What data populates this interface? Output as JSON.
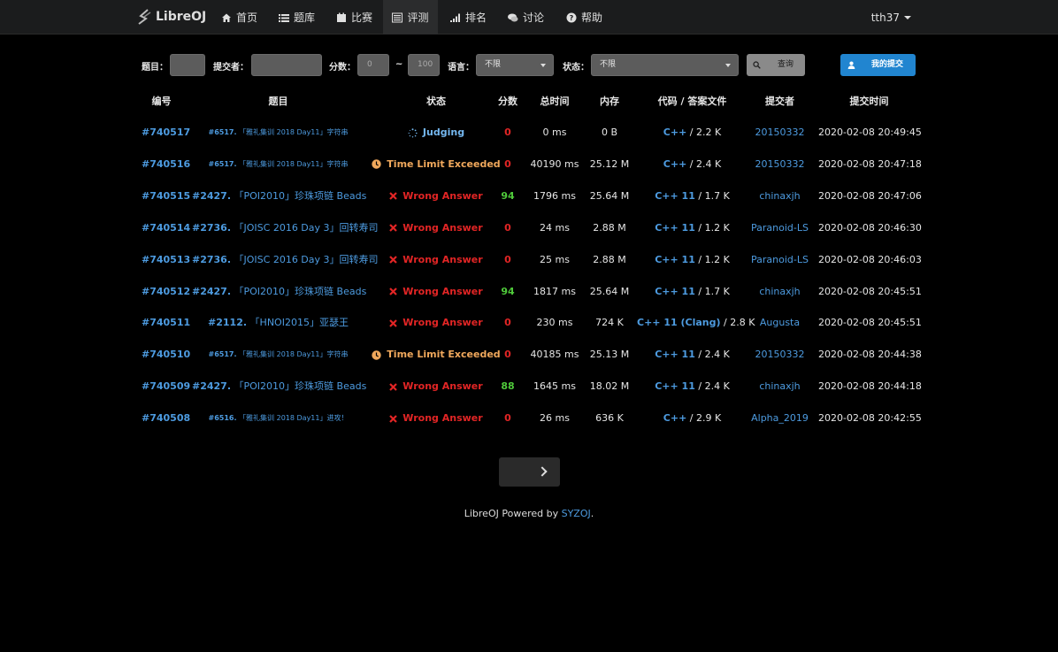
{
  "nav": {
    "brand": "LibreOJ",
    "items": [
      {
        "label": "首页",
        "icon": "home-icon"
      },
      {
        "label": "题库",
        "icon": "list-icon"
      },
      {
        "label": "比赛",
        "icon": "calendar-icon"
      },
      {
        "label": "评测",
        "icon": "tasks-icon"
      },
      {
        "label": "排名",
        "icon": "signal-icon"
      },
      {
        "label": "讨论",
        "icon": "comments-icon"
      },
      {
        "label": "帮助",
        "icon": "help-icon"
      }
    ],
    "user": "tth37"
  },
  "filter": {
    "problem_label": "题目：",
    "submitter_label": "提交者：",
    "score_label": "分数：",
    "score_min_placeholder": "0",
    "tilde": "~",
    "score_max_placeholder": "100",
    "language_label": "语言：",
    "language_value": "不限",
    "status_label": "状态：",
    "status_value": "不限",
    "query_button": "查询",
    "my_submissions_button": "我的提交"
  },
  "table": {
    "headers": [
      "编号",
      "题目",
      "状态",
      "分数",
      "总时间",
      "内存",
      "代码 / 答案文件",
      "提交者",
      "提交时间"
    ],
    "rows": [
      {
        "id": "#740517",
        "pid": "#6517.",
        "ptitle": "「雅礼集训 2018 Day11」字符串",
        "psize": "small",
        "status": "Judging",
        "stype": "judging",
        "score": "0",
        "scolor": "red",
        "time": "0 ms",
        "mem": "0 B",
        "lang": "C++",
        "size": " / 2.2 K",
        "user": "20150332",
        "subtime": "2020-02-08 20:49:45"
      },
      {
        "id": "#740516",
        "pid": "#6517.",
        "ptitle": "「雅礼集训 2018 Day11」字符串",
        "psize": "small",
        "status": "Time Limit Exceeded",
        "stype": "tle",
        "score": "0",
        "scolor": "red",
        "time": "40190 ms",
        "mem": "25.12 M",
        "lang": "C++",
        "size": " / 2.4 K",
        "user": "20150332",
        "subtime": "2020-02-08 20:47:18"
      },
      {
        "id": "#740515",
        "pid": "#2427.",
        "ptitle": "「POI2010」珍珠项链 Beads",
        "psize": "norm",
        "status": "Wrong Answer",
        "stype": "wa",
        "score": "94",
        "scolor": "green",
        "time": "1796 ms",
        "mem": "25.64 M",
        "lang": "C++ 11",
        "size": " / 1.7 K",
        "user": "chinaxjh",
        "subtime": "2020-02-08 20:47:06"
      },
      {
        "id": "#740514",
        "pid": "#2736.",
        "ptitle": "「JOISC 2016 Day 3」回转寿司",
        "psize": "norm",
        "status": "Wrong Answer",
        "stype": "wa",
        "score": "0",
        "scolor": "red",
        "time": "24 ms",
        "mem": "2.88 M",
        "lang": "C++ 11",
        "size": " / 1.2 K",
        "user": "Paranoid-LS",
        "subtime": "2020-02-08 20:46:30"
      },
      {
        "id": "#740513",
        "pid": "#2736.",
        "ptitle": "「JOISC 2016 Day 3」回转寿司",
        "psize": "norm",
        "status": "Wrong Answer",
        "stype": "wa",
        "score": "0",
        "scolor": "red",
        "time": "25 ms",
        "mem": "2.88 M",
        "lang": "C++ 11",
        "size": " / 1.2 K",
        "user": "Paranoid-LS",
        "subtime": "2020-02-08 20:46:03"
      },
      {
        "id": "#740512",
        "pid": "#2427.",
        "ptitle": "「POI2010」珍珠项链 Beads",
        "psize": "norm",
        "status": "Wrong Answer",
        "stype": "wa",
        "score": "94",
        "scolor": "green",
        "time": "1817 ms",
        "mem": "25.64 M",
        "lang": "C++ 11",
        "size": " / 1.7 K",
        "user": "chinaxjh",
        "subtime": "2020-02-08 20:45:51"
      },
      {
        "id": "#740511",
        "pid": "#2112.",
        "ptitle": "「HNOI2015」亚瑟王",
        "psize": "norm",
        "status": "Wrong Answer",
        "stype": "wa",
        "score": "0",
        "scolor": "red",
        "time": "230 ms",
        "mem": "724 K",
        "lang": "C++ 11 (Clang)",
        "size": " / 2.8 K",
        "user": "Augusta",
        "subtime": "2020-02-08 20:45:51"
      },
      {
        "id": "#740510",
        "pid": "#6517.",
        "ptitle": "「雅礼集训 2018 Day11」字符串",
        "psize": "small",
        "status": "Time Limit Exceeded",
        "stype": "tle",
        "score": "0",
        "scolor": "red",
        "time": "40185 ms",
        "mem": "25.13 M",
        "lang": "C++ 11",
        "size": " / 2.4 K",
        "user": "20150332",
        "subtime": "2020-02-08 20:44:38"
      },
      {
        "id": "#740509",
        "pid": "#2427.",
        "ptitle": "「POI2010」珍珠项链 Beads",
        "psize": "norm",
        "status": "Wrong Answer",
        "stype": "wa",
        "score": "88",
        "scolor": "green",
        "time": "1645 ms",
        "mem": "18.02 M",
        "lang": "C++ 11",
        "size": " / 2.4 K",
        "user": "chinaxjh",
        "subtime": "2020-02-08 20:44:18"
      },
      {
        "id": "#740508",
        "pid": "#6516.",
        "ptitle": "「雅礼集训 2018 Day11」进攻！",
        "psize": "small",
        "status": "Wrong Answer",
        "stype": "wa",
        "score": "0",
        "scolor": "red",
        "time": "26 ms",
        "mem": "636 K",
        "lang": "C++",
        "size": " / 2.9 K",
        "user": "Alpha_2019",
        "subtime": "2020-02-08 20:42:55"
      }
    ]
  },
  "footer": {
    "text": "LibreOJ Powered by ",
    "link": "SYZOJ",
    "suffix": "."
  }
}
